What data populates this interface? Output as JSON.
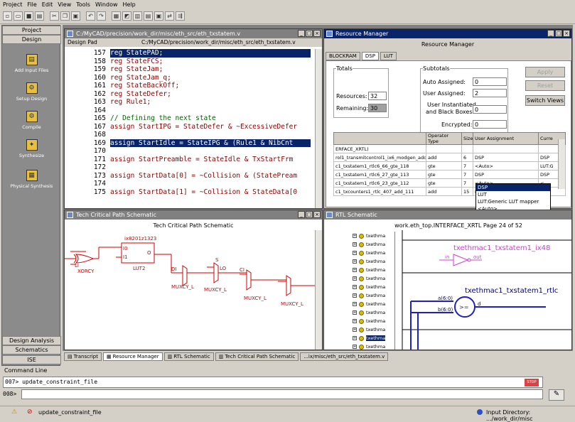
{
  "menu": [
    "Project",
    "File",
    "Edit",
    "View",
    "Tools",
    "Window",
    "Help"
  ],
  "sidebar": {
    "top_buttons": [
      "Project",
      "Design"
    ],
    "items": [
      "Add Input Files",
      "Setup Design",
      "Compile",
      "Synthesize",
      "Physical Synthesis"
    ],
    "bottom_buttons": [
      "Design Analysis",
      "Schematics",
      "ISE"
    ]
  },
  "editor": {
    "label": "Design Pad",
    "path": "C:/MyCAD/precision/work_dir/misc/eth_src/eth_txstatem.v",
    "title": "C:/MyCAD/precision/work_dir/misc/eth_src/eth_txstatem.v",
    "lines": [
      {
        "n": "157",
        "t": "reg StatePAD;",
        "sel": true
      },
      {
        "n": "158",
        "t": "reg StateFCS;"
      },
      {
        "n": "159",
        "t": "reg StateJam;"
      },
      {
        "n": "160",
        "t": "reg StateJam_q;"
      },
      {
        "n": "161",
        "t": "reg StateBackOff;"
      },
      {
        "n": "162",
        "t": "reg StateDefer;"
      },
      {
        "n": "163",
        "t": "reg Rule1;"
      },
      {
        "n": "164",
        "t": ""
      },
      {
        "n": "165",
        "t": "// Defining the next state",
        "cmt": true
      },
      {
        "n": "167",
        "t": "assign StartIPG = StateDefer & ~ExcessiveDefer"
      },
      {
        "n": "168",
        "t": ""
      },
      {
        "n": "169",
        "t": "assign StartIdle = StateIPG & (Rule1 & NibCnt",
        "sel": true
      },
      {
        "n": "170",
        "t": ""
      },
      {
        "n": "171",
        "t": "assign StartPreamble = StateIdle & TxStartFrm"
      },
      {
        "n": "172",
        "t": ""
      },
      {
        "n": "173",
        "t": "assign StartData[0] = ~Collision & (StatePream"
      },
      {
        "n": "174",
        "t": ""
      },
      {
        "n": "175",
        "t": "assign StartData[1] = ~Collision & StateData[0"
      }
    ]
  },
  "resource_manager": {
    "title": "Resource Manager",
    "heading": "Resource Manager",
    "tabs": [
      "BLOCKRAM",
      "DSP",
      "LUT"
    ],
    "totals_label": "Totals",
    "resources_label": "Resources:",
    "resources_value": "32",
    "remaining_label": "Remaining:",
    "remaining_value": "30",
    "subtotals_label": "Subtotals",
    "auto_label": "Auto Assigned:",
    "auto_value": "0",
    "user_label": "User Assigned:",
    "user_value": "2",
    "inst_label1": "User Instantiated",
    "inst_label2": "and Black Boxes:",
    "inst_value": "0",
    "enc_label": "Encrypted:",
    "enc_value": "0",
    "buttons": [
      "Apply",
      "Reset",
      "Switch Views"
    ],
    "columns": [
      "",
      "Operator Type",
      "Size",
      "User Assignment",
      "Curre"
    ],
    "rows": [
      {
        "name": "ERFACE_XRTL)",
        "op": "",
        "size": "",
        "ua": "",
        "cur": ""
      },
      {
        "name": "rol1_transmitcontrol1_ix6_modgen_add_1",
        "op": "add",
        "size": "6",
        "ua": "DSP",
        "cur": "DSP"
      },
      {
        "name": "c1_txstatem1_rtlc6_66_gte_118",
        "op": "gte",
        "size": "7",
        "ua": "<Auto>",
        "cur": "LUT:G"
      },
      {
        "name": "c1_txstatem1_rtlc6_27_gte_113",
        "op": "gte",
        "size": "7",
        "ua": "DSP",
        "cur": "DSP"
      },
      {
        "name": "c1_txstatem1_rtlc6_23_gte_112",
        "op": "gte",
        "size": "7",
        "ua": "<Auto>",
        "cur": "<"
      },
      {
        "name": "c1_txcounters1_rtlc_407_add_111",
        "op": "add",
        "size": "15",
        "ua": "DSP",
        "cur": ""
      }
    ],
    "dropdown_options": [
      "DSP",
      "LUT",
      "LUT:Generic LUT mapper",
      "<Auto>"
    ]
  },
  "tech_schematic": {
    "title": "Tech Critical Path Schematic",
    "heading": "Tech Critical Path Schematic",
    "labels": {
      "inst": "ix8201z1323",
      "lut": "LUT2",
      "xor": "XORCY",
      "i0": "I0",
      "i1": "I1",
      "o": "O",
      "di": "DI",
      "s": "S",
      "ci": "CI",
      "lo": "LO",
      "mux1": "MUXCY_L",
      "mux2": "MUXCY_L",
      "mux3": "MUXCY_L",
      "mux4": "MUXCY_L",
      "li": "LI",
      "nin": "in"
    }
  },
  "rtl_schematic": {
    "title": "RTL Schematic",
    "heading": "work.eth_top.INTERFACE_XRTL Page 24 of 52",
    "tree_items": [
      "txethma",
      "txethma",
      "txethma",
      "txethma",
      "txethma",
      "txethma",
      "txethma",
      "txethma",
      "txethma",
      "txethma",
      "txethma",
      "txethma",
      "txethma",
      "txethma"
    ],
    "inv_label": "txethmac1_txstatem1_ix48",
    "inv_in": "in",
    "inv_out": "out",
    "cmp_label": "txethmac1_txstatem1_rtlc",
    "cmp_a": "a(6:0)",
    "cmp_b": "b(6:0)",
    "cmp_d": "d",
    "cmp_op": ">="
  },
  "bottom_tabs": [
    "Transcript",
    "Resource Manager",
    "RTL Schematic",
    "Tech Critical Path Schematic",
    "...ix/misc/eth_src/eth_txstatem.v"
  ],
  "command_line": {
    "title": "Command Line",
    "line1_prompt": "007>",
    "line1_text": "update_constraint_file",
    "line2_prompt": "008>",
    "stop_label": "STOP"
  },
  "status": {
    "text": "update_constraint_file",
    "input_dir": "Input Directory: .../work_dir/misc"
  }
}
